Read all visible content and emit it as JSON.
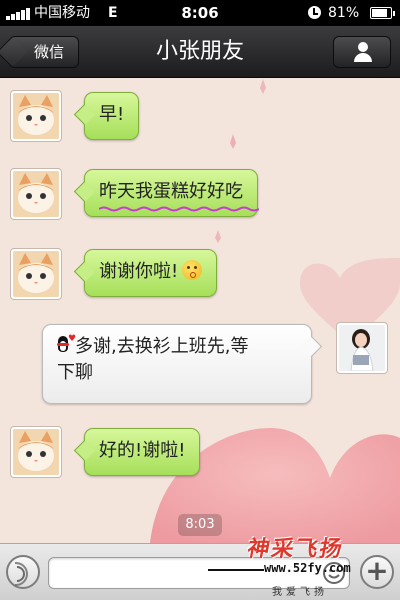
{
  "status_bar": {
    "carrier": "中国移动",
    "network": "E",
    "time": "8:06",
    "battery_percent": "81%",
    "battery_level": 0.81
  },
  "nav": {
    "back_label": "微信",
    "title": "小张朋友",
    "profile_icon": "person-icon"
  },
  "messages": [
    {
      "sender": "friend",
      "text": "早!",
      "avatar": "cat-avatar"
    },
    {
      "sender": "friend",
      "text": "昨天我蛋糕好好吃",
      "avatar": "cat-avatar"
    },
    {
      "sender": "friend",
      "text": "谢谢你啦!",
      "emoji": "kiss-emoji",
      "avatar": "cat-avatar"
    },
    {
      "sender": "me",
      "line1": "多谢,去换衫上班先,等",
      "line2": "下聊",
      "icon": "qq-penguin-icon",
      "avatar": "girl-photo-avatar"
    },
    {
      "sender": "friend",
      "text": "好的!谢啦!",
      "avatar": "cat-avatar"
    }
  ],
  "timestamp": "8:03",
  "input_bar": {
    "voice_icon": "voice-icon",
    "emoji_icon": "smiley-icon",
    "add_icon": "plus-icon",
    "add_label": "+"
  },
  "watermark": {
    "title": "神采飞扬",
    "url": "www.52fy.com",
    "subtitle": "我爱飞扬"
  },
  "colors": {
    "incoming_bubble": "#b8e86f",
    "outgoing_bubble": "#ffffff",
    "chat_background": "#f3e4dc",
    "heart_pink": "#ee8f99",
    "watermark_red": "#e0372c"
  }
}
